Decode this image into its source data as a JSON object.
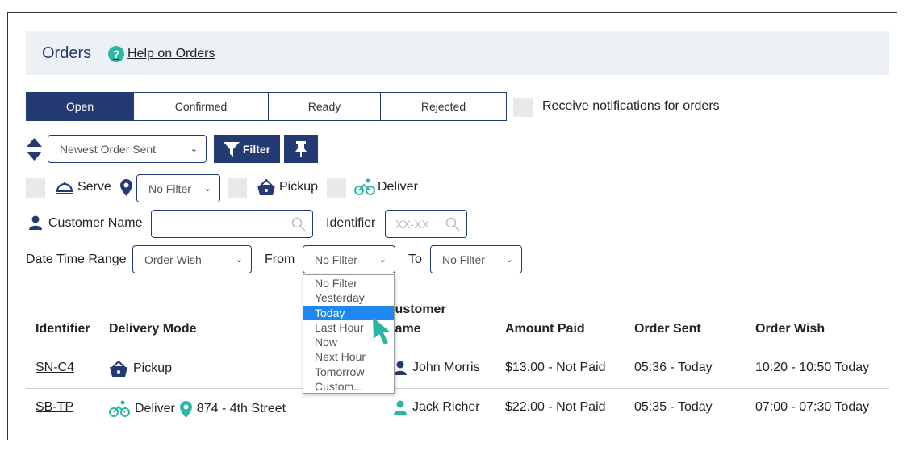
{
  "header": {
    "title": "Orders",
    "help_link": "Help on Orders",
    "help_icon": "question-circle-icon"
  },
  "tabs": [
    {
      "label": "Open",
      "active": true
    },
    {
      "label": "Confirmed"
    },
    {
      "label": "Ready"
    },
    {
      "label": "Rejected"
    }
  ],
  "notifications": {
    "label": "Receive notifications for orders",
    "checked": false
  },
  "sort": {
    "selected": "Newest Order Sent",
    "filter_button": "Filter",
    "pin_icon": "thumbtack-icon"
  },
  "delivery_filters": {
    "serve": "Serve",
    "location_select": "No Filter",
    "pickup": "Pickup",
    "deliver": "Deliver"
  },
  "search": {
    "customer_label": "Customer Name",
    "customer_value": "",
    "identifier_label": "Identifier",
    "identifier_placeholder": "XX-XX"
  },
  "date_range": {
    "label": "Date Time Range",
    "type_select": "Order Wish",
    "from_label": "From",
    "from_select": "No Filter",
    "to_label": "To",
    "to_select": "No Filter"
  },
  "from_dropdown": {
    "options": [
      "No Filter",
      "Yesterday",
      "Today",
      "Last Hour",
      "Now",
      "Next Hour",
      "Tomorrow",
      "Custom..."
    ],
    "highlighted": "Today"
  },
  "table": {
    "headers": {
      "identifier": "Identifier",
      "delivery_mode": "Delivery Mode",
      "customer_line1": "Customer",
      "customer_line2": "Name",
      "amount": "Amount Paid",
      "sent": "Order Sent",
      "wish": "Order Wish"
    },
    "rows": [
      {
        "identifier": "SN-C4",
        "mode": "Pickup",
        "address": "",
        "customer": "John Morris",
        "amount": "$13.00 - Not Paid",
        "sent": "05:36 - Today",
        "wish": "10:20 - 10:50 Today"
      },
      {
        "identifier": "SB-TP",
        "mode": "Deliver",
        "address": "874 - 4th Street",
        "customer": "Jack Richer",
        "amount": "$22.00 - Not Paid",
        "sent": "05:35 - Today",
        "wish": "07:00 - 07:30 Today"
      }
    ]
  },
  "colors": {
    "navy": "#243a73",
    "teal": "#2fb5a4",
    "highlight": "#1e88f0",
    "header_bg": "#edf1f5"
  }
}
